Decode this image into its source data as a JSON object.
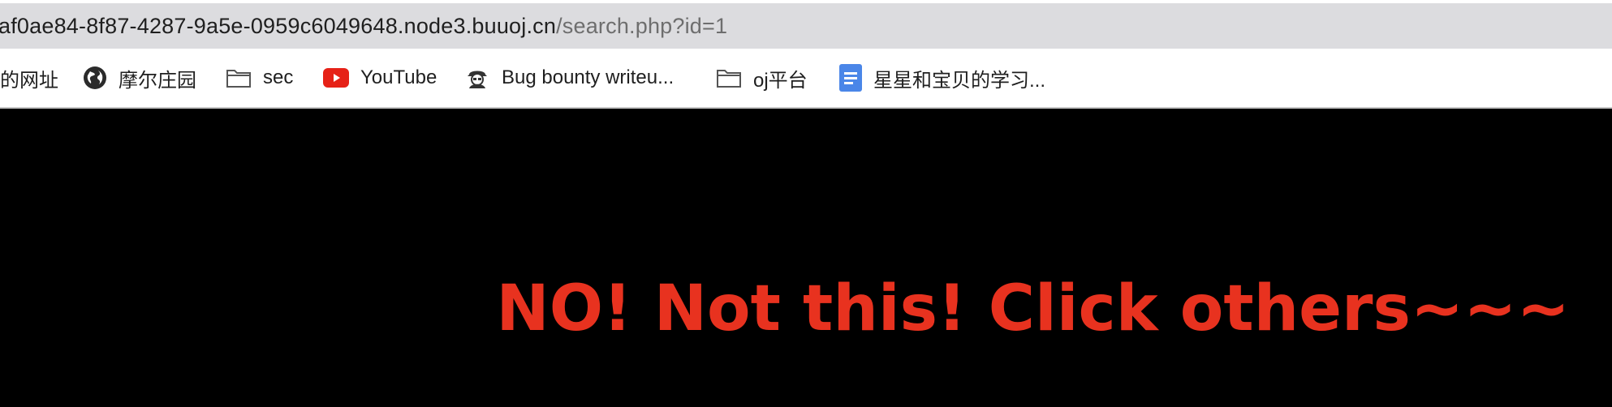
{
  "address_bar": {
    "host": "af0ae84-8f87-4287-9a5e-0959c6049648.node3.buuoj.cn",
    "path": "/search.php?id=1"
  },
  "bookmarks": [
    {
      "label": "的网址",
      "icon": "none"
    },
    {
      "label": "摩尔庄园",
      "icon": "globe-icon"
    },
    {
      "label": "sec",
      "icon": "folder-icon"
    },
    {
      "label": "YouTube",
      "icon": "youtube-icon"
    },
    {
      "label": "Bug bounty writeu...",
      "icon": "hacker-icon"
    },
    {
      "label": "oj平台",
      "icon": "folder-icon"
    },
    {
      "label": "星星和宝贝的学习...",
      "icon": "google-docs-icon"
    }
  ],
  "page": {
    "message": "NO! Not this! Click others~~~",
    "message_color": "#e8321f",
    "background_color": "#000000"
  }
}
